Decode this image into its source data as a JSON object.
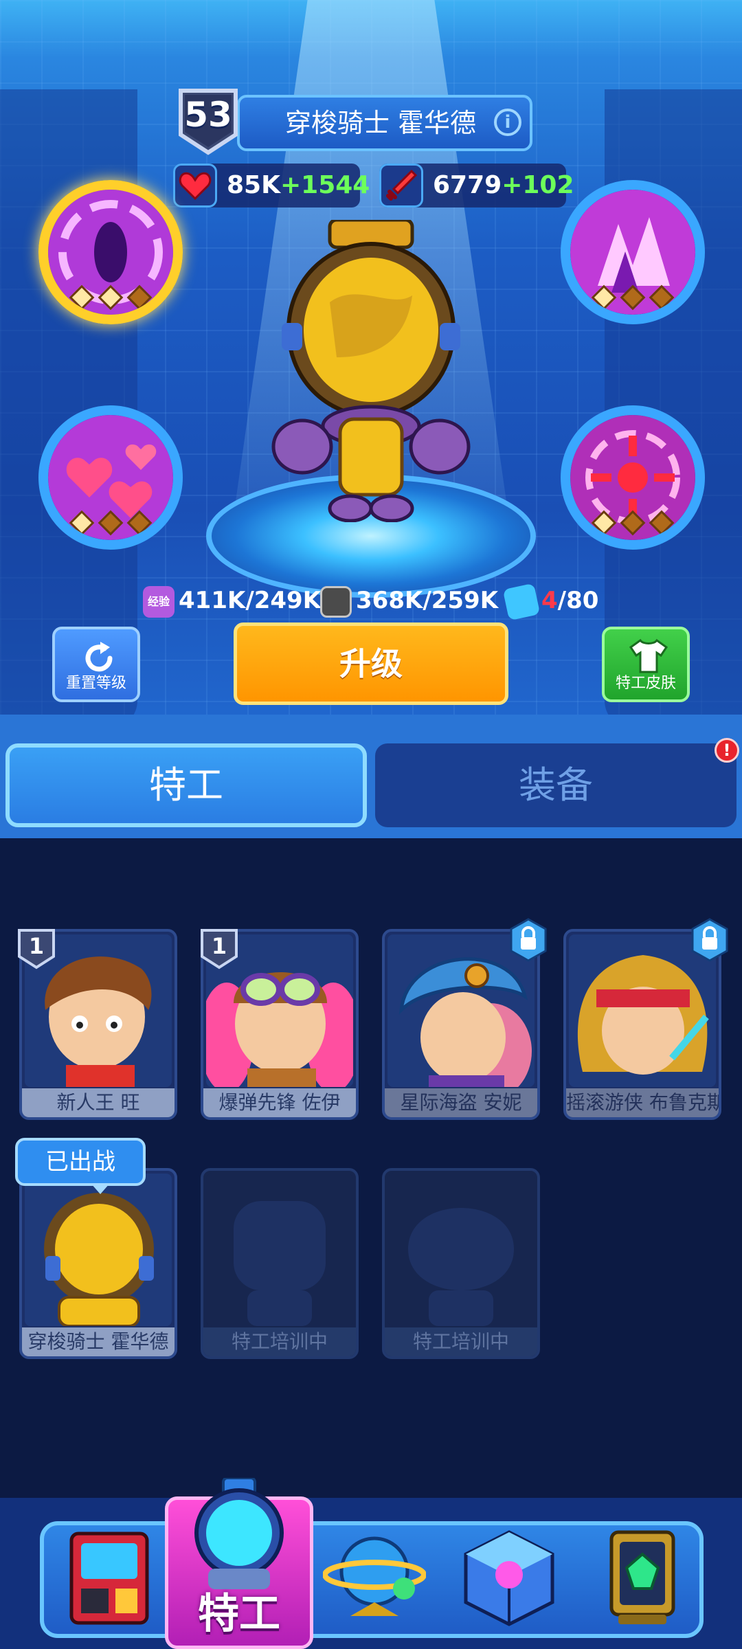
{
  "hero": {
    "level": "53",
    "name": "穿梭骑士 霍华德",
    "hp": "85K",
    "hp_bonus": "+1544",
    "attack": "6779",
    "attack_bonus": "+102"
  },
  "resources": {
    "exp_icon_label": "经验",
    "exp": "411K/249K",
    "tape": "368K/259K",
    "cards_have": "4",
    "cards_need": "/80"
  },
  "buttons": {
    "reset": "重置等级",
    "upgrade": "升级",
    "skin": "特工皮肤"
  },
  "tabs": {
    "agent": "特工",
    "equipment": "装备",
    "alert": "!"
  },
  "roster": {
    "cards": [
      {
        "name": "新人王 旺",
        "level": "1"
      },
      {
        "name": "爆弹先锋 佐伊",
        "level": "1"
      },
      {
        "name": "星际海盗 安妮"
      },
      {
        "name": "摇滚游侠 布鲁克斯"
      },
      {
        "name": "穿梭骑士 霍华德"
      },
      {
        "name": "特工培训中"
      },
      {
        "name": "特工培训中"
      }
    ],
    "deployed_tag": "已出战"
  },
  "nav": {
    "agent_label": "特工"
  },
  "colors": {
    "accent_gold": "#ffcf2a",
    "upgrade_orange": "#ff9500",
    "bonus_green": "#6dff5a",
    "alert_red": "#e8232c",
    "nav_active_magenta": "#ff4fd8"
  }
}
